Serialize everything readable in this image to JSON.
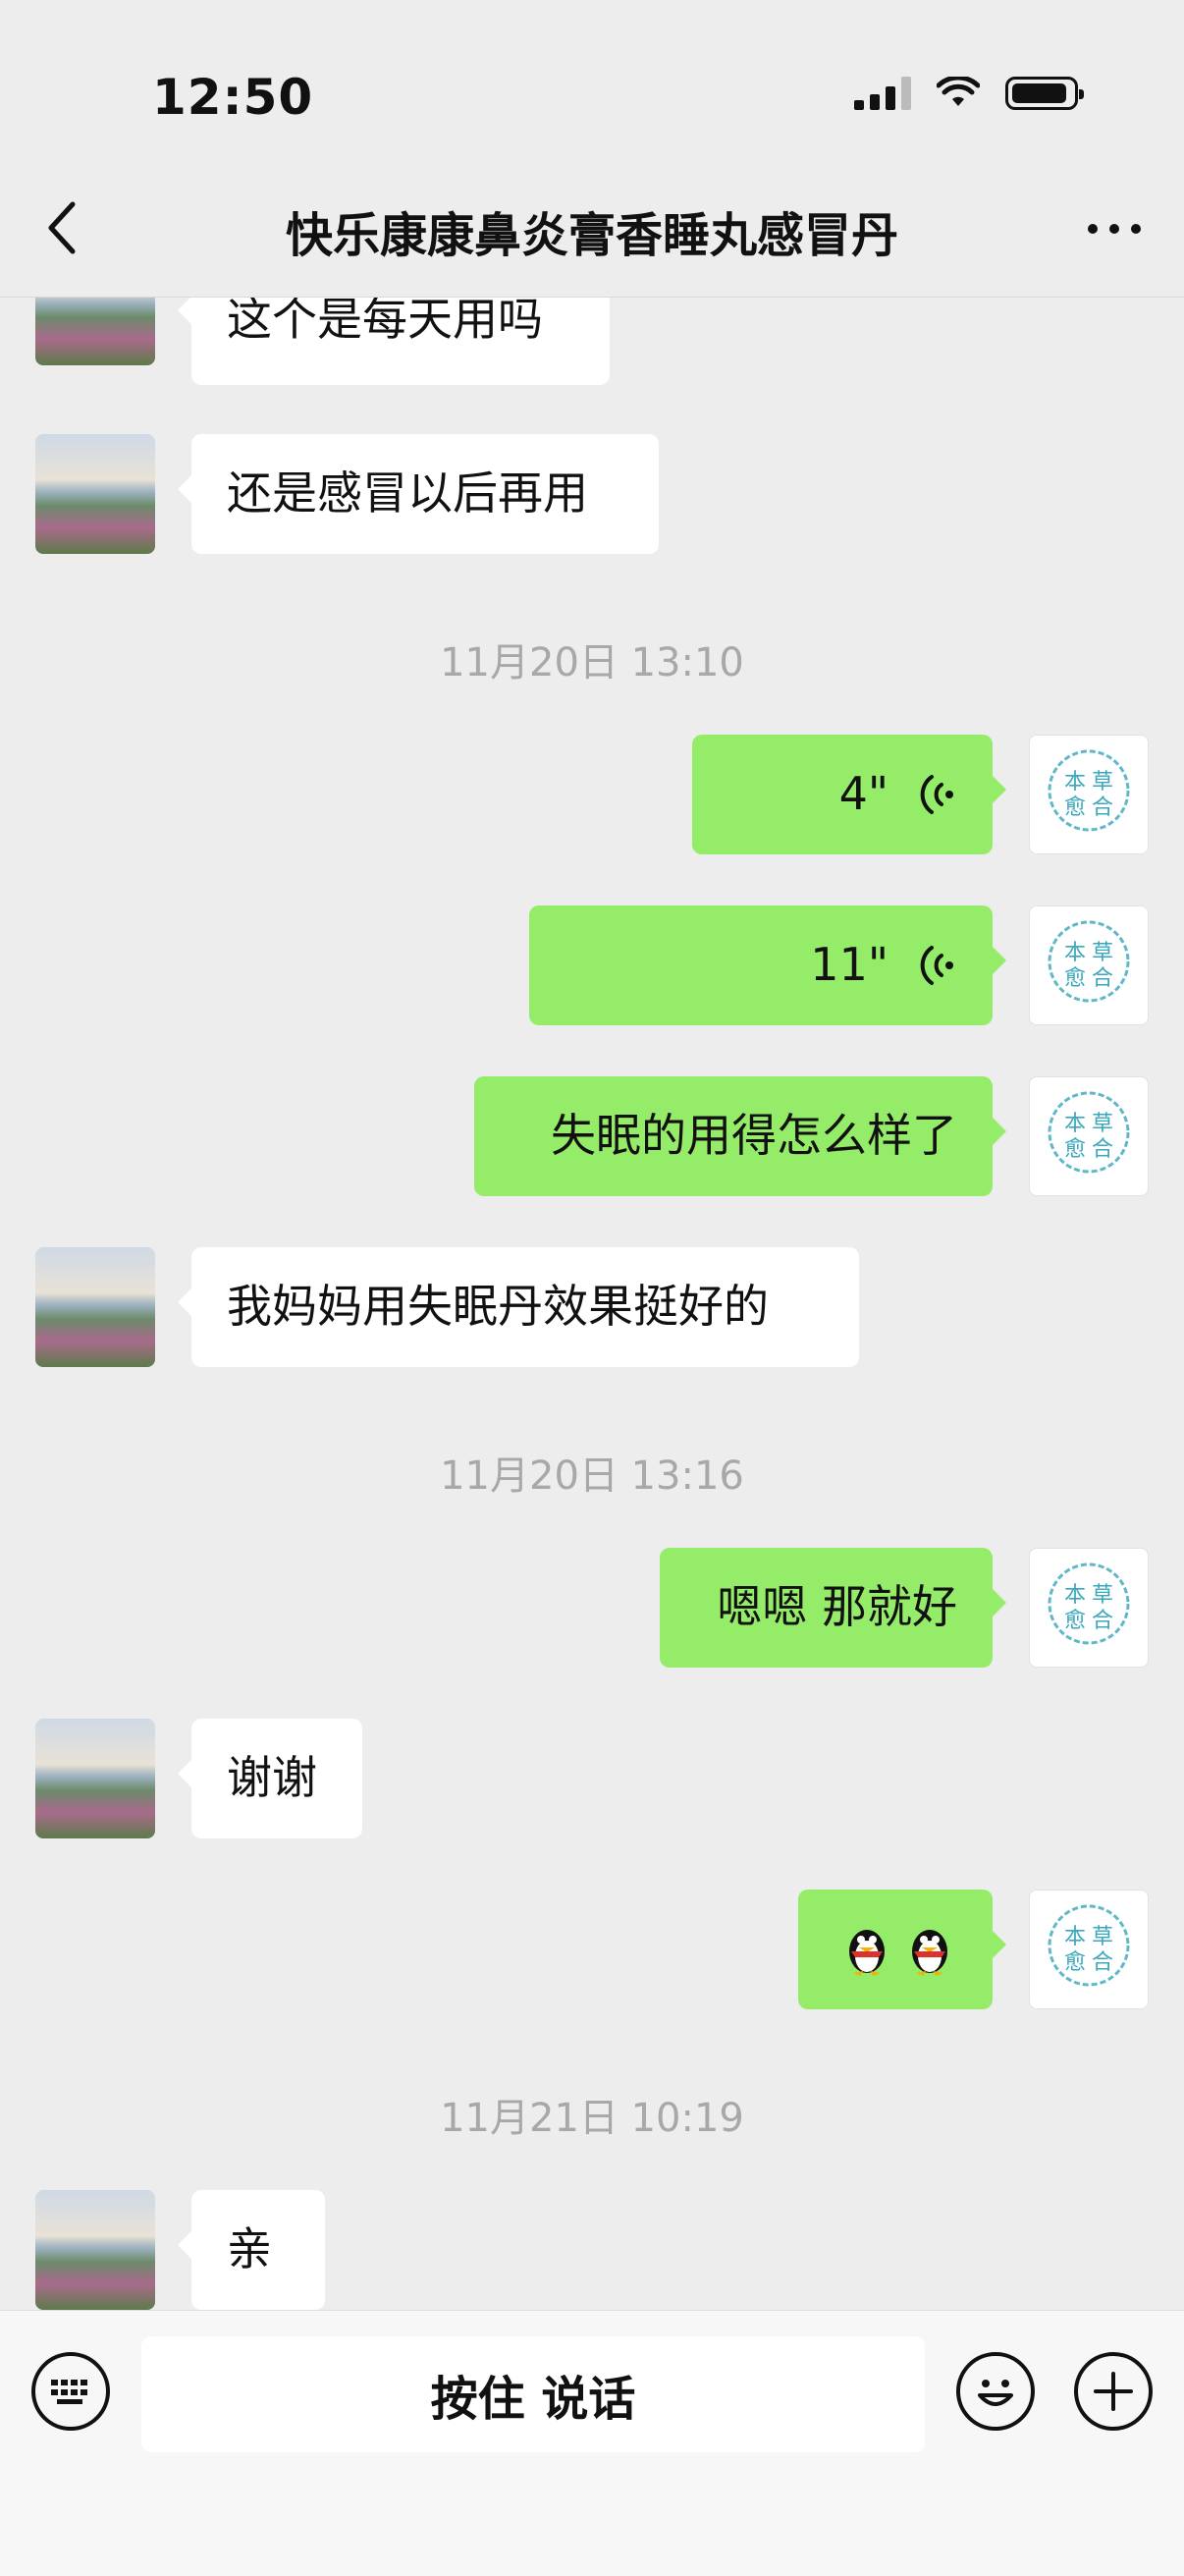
{
  "status_bar": {
    "time": "12:50"
  },
  "header": {
    "title": "快乐康康鼻炎膏香睡丸感冒丹"
  },
  "messages": [
    {
      "text": "这个是每天用吗"
    },
    {
      "text": "还是感冒以后再用"
    },
    {
      "timestamp": "11月20日 13:10"
    },
    {
      "voice_duration": "4\""
    },
    {
      "voice_duration": "11\""
    },
    {
      "text": "失眠的用得怎么样了"
    },
    {
      "text": "我妈妈用失眠丹效果挺好的"
    },
    {
      "timestamp": "11月20日 13:16"
    },
    {
      "text": "嗯嗯 那就好"
    },
    {
      "text": "谢谢"
    },
    {
      "emoji": "penguin-emoji"
    },
    {
      "timestamp": "11月21日 10:19"
    },
    {
      "text": "亲"
    }
  ],
  "seal_text": [
    "本",
    "草",
    "愈",
    "合"
  ],
  "input_bar": {
    "talk_label": "按住 说话"
  },
  "colors": {
    "outgoing_bubble": "#95ec69",
    "incoming_bubble": "#ffffff",
    "background": "#ededed"
  }
}
